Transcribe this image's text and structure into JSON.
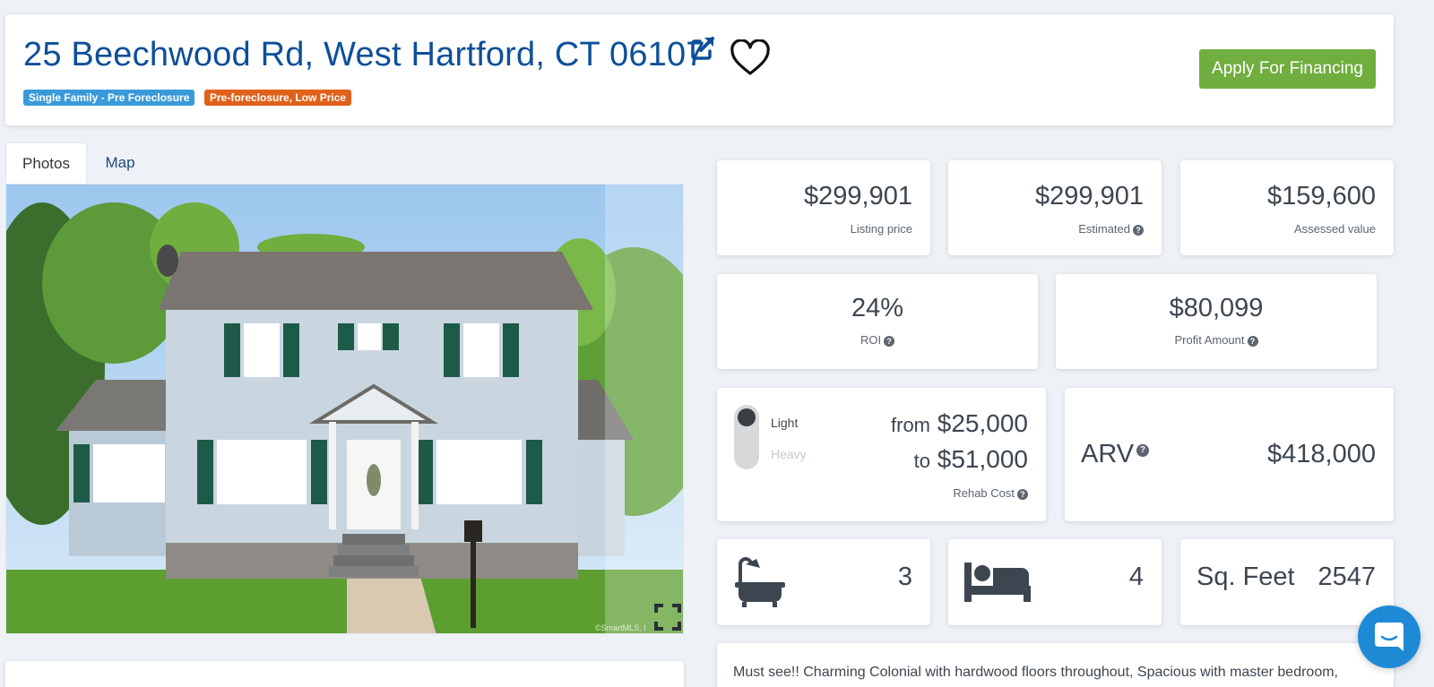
{
  "header": {
    "address": "25 Beechwood Rd, West Hartford, CT 06107",
    "badges": [
      "Single Family - Pre Foreclosure",
      "Pre-foreclosure, Low Price"
    ],
    "apply_label": "Apply For Financing"
  },
  "tabs": [
    {
      "label": "Photos",
      "active": true
    },
    {
      "label": "Map",
      "active": false
    }
  ],
  "photo": {
    "watermark": "©SmartMLS, I"
  },
  "stats": {
    "listing_price": {
      "value": "$299,901",
      "label": "Listing price"
    },
    "estimated": {
      "value": "$299,901",
      "label": "Estimated"
    },
    "assessed": {
      "value": "$159,600",
      "label": "Assessed value"
    },
    "roi": {
      "value": "24%",
      "label": "ROI"
    },
    "profit": {
      "value": "$80,099",
      "label": "Profit Amount"
    },
    "rehab": {
      "light_label": "Light",
      "heavy_label": "Heavy",
      "from_word": "from",
      "from_value": "$25,000",
      "to_word": "to",
      "to_value": "$51,000",
      "label": "Rehab Cost"
    },
    "arv": {
      "label": "ARV",
      "value": "$418,000"
    },
    "baths": "3",
    "beds": "4",
    "sqft": {
      "label": "Sq. Feet",
      "value": "2547"
    }
  },
  "description": "Must see!! Charming Colonial with hardwood floors throughout, Spacious with master bedroom,",
  "colors": {
    "address": "#0d4f99",
    "badge_blue": "#3a9ad9",
    "badge_orange": "#e0611a",
    "apply_green": "#6fae3f",
    "chat_blue": "#1e8ad6"
  },
  "icons": [
    "external-link-icon",
    "heart-icon",
    "fullscreen-icon",
    "bathtub-icon",
    "bed-icon",
    "chat-icon",
    "help-icon"
  ]
}
